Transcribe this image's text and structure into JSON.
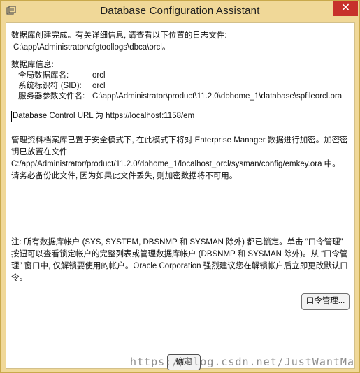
{
  "window": {
    "title": "Database Configuration Assistant",
    "close_label": "✕",
    "app_icon": "dbca-icon"
  },
  "content": {
    "intro_line1": "数据库创建完成。有关详细信息, 请查看以下位置的日志文件:",
    "intro_path": "C:\\app\\Administrator\\cfgtoollogs\\dbca\\orcl。",
    "db_info_header": "数据库信息:",
    "db_info": [
      {
        "label": "全局数据库名:",
        "value": "orcl"
      },
      {
        "label": "系统标识符 (SID):",
        "value": "orcl"
      },
      {
        "label": "服务器参数文件名:",
        "value": "C:\\app\\Administrator\\product\\11.2.0\\dbhome_1\\database\\spfileorcl.ora"
      }
    ],
    "em_url_line": "Database Control URL 为 https://localhost:1158/em",
    "secure_mode_text": "管理资料档案库已置于安全模式下, 在此模式下将对 Enterprise Manager 数据进行加密。加密密钥已放置在文件 C:/app/Administrator/product/11.2.0/dbhome_1/localhost_orcl/sysman/config/emkey.ora 中。请务必备份此文件, 因为如果此文件丢失, 则加密数据将不可用。",
    "note_text": "注: 所有数据库帐户 (SYS, SYSTEM, DBSNMP 和 SYSMAN 除外) 都已锁定。单击 “口令管理” 按钮可以查看锁定帐户的完整列表或管理数据库帐户 (DBSNMP 和 SYSMAN 除外)。从 “口令管理” 窗口中, 仅解锁要使用的帐户。Oracle Corporation 强烈建议您在解锁帐户后立即更改默认口令。"
  },
  "buttons": {
    "password_management": "口令管理...",
    "ok": "确定"
  },
  "watermark": "https://blog.csdn.net/JustWantMa"
}
